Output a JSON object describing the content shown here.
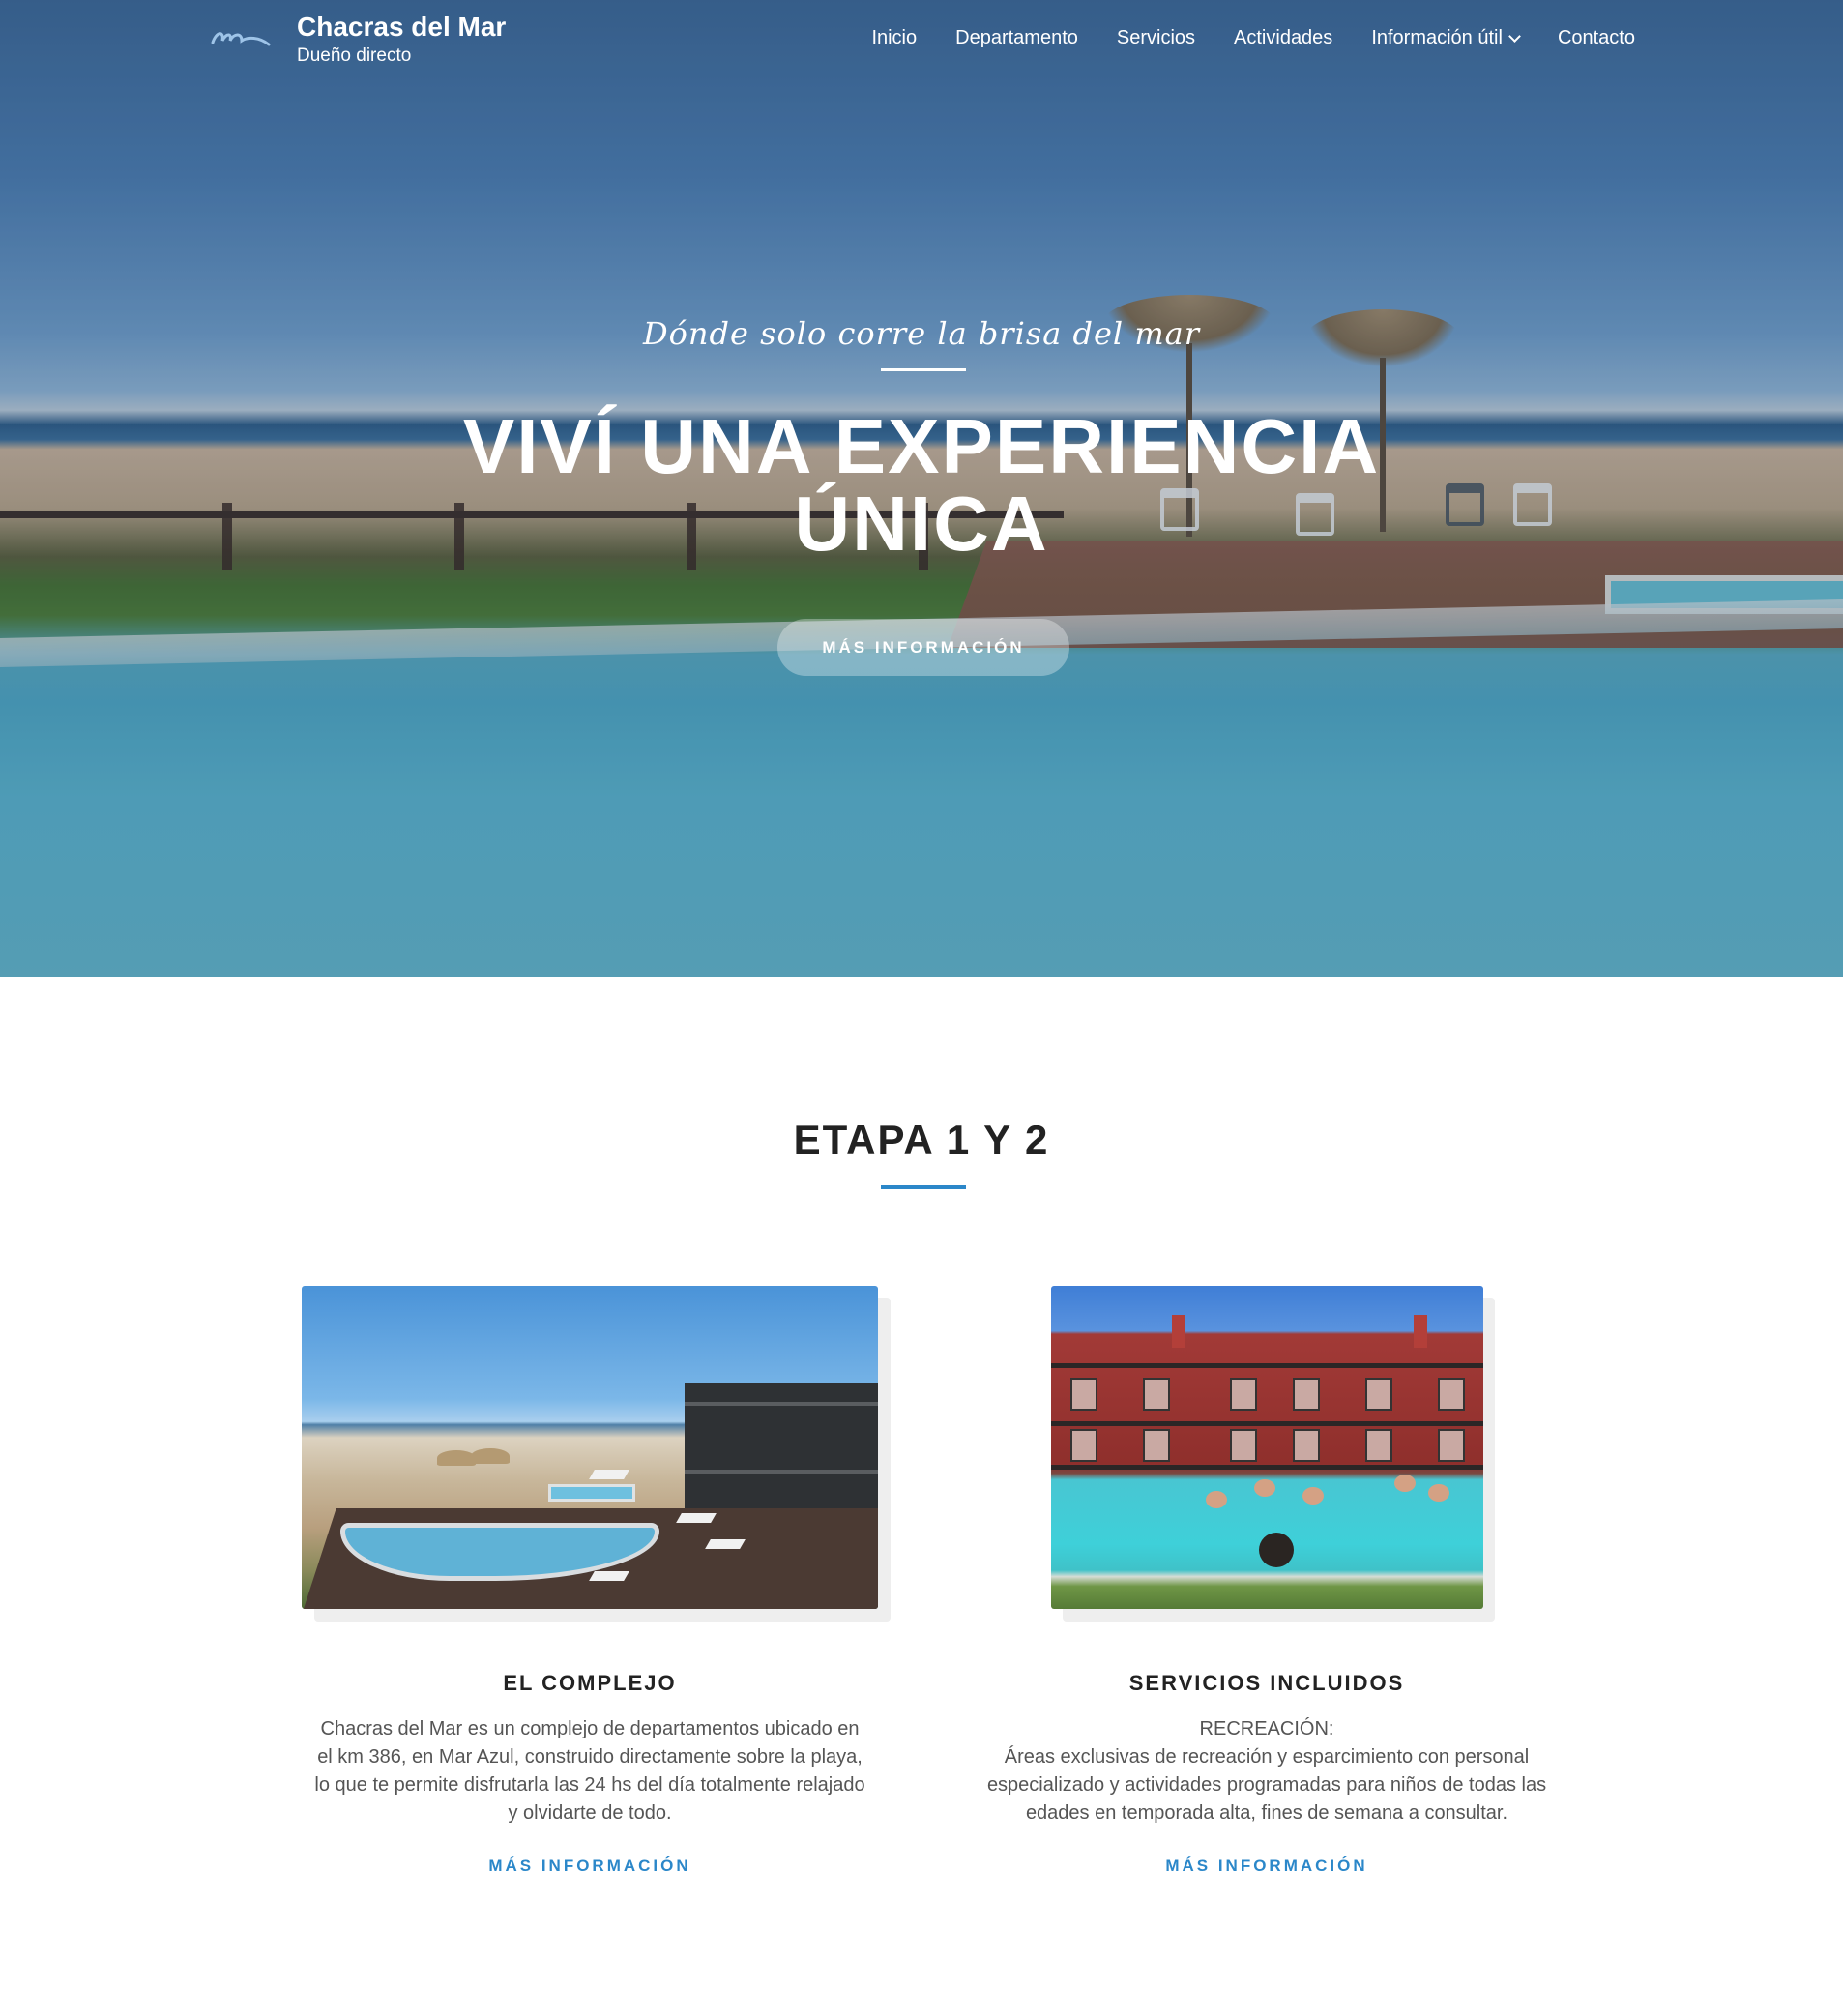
{
  "header": {
    "site_title": "Chacras del Mar",
    "site_tagline": "Dueño directo",
    "menu": [
      {
        "label": "Inicio"
      },
      {
        "label": "Departamento"
      },
      {
        "label": "Servicios"
      },
      {
        "label": "Actividades"
      },
      {
        "label": "Información útil",
        "has_dropdown": true
      },
      {
        "label": "Contacto"
      }
    ]
  },
  "hero": {
    "subtitle": "Dónde solo corre la brisa del mar",
    "title_line1": "VIVÍ UNA EXPERIENCIA",
    "title_line2": "ÚNICA",
    "button_label": "MÁS INFORMACIÓN"
  },
  "section": {
    "title": "ETAPA 1 Y 2",
    "accent_color": "#2b87c9",
    "cards": [
      {
        "title": "EL COMPLEJO",
        "text": "Chacras del Mar es un complejo de departamentos ubicado en el km 386, en Mar Azul, construido directamente sobre la playa, lo que te permite disfrutarla las 24 hs del día totalmente relajado y olvidarte de todo.",
        "link_label": "MÁS INFORMACIÓN"
      },
      {
        "title": "SERVICIOS INCLUIDOS",
        "text_heading": "RECREACIÓN:",
        "text": "Áreas exclusivas de recreación y esparcimiento con personal especializado y actividades programadas para niños de todas las edades en temporada alta, fines de semana a consultar.",
        "link_label": "MÁS INFORMACIÓN"
      }
    ]
  }
}
